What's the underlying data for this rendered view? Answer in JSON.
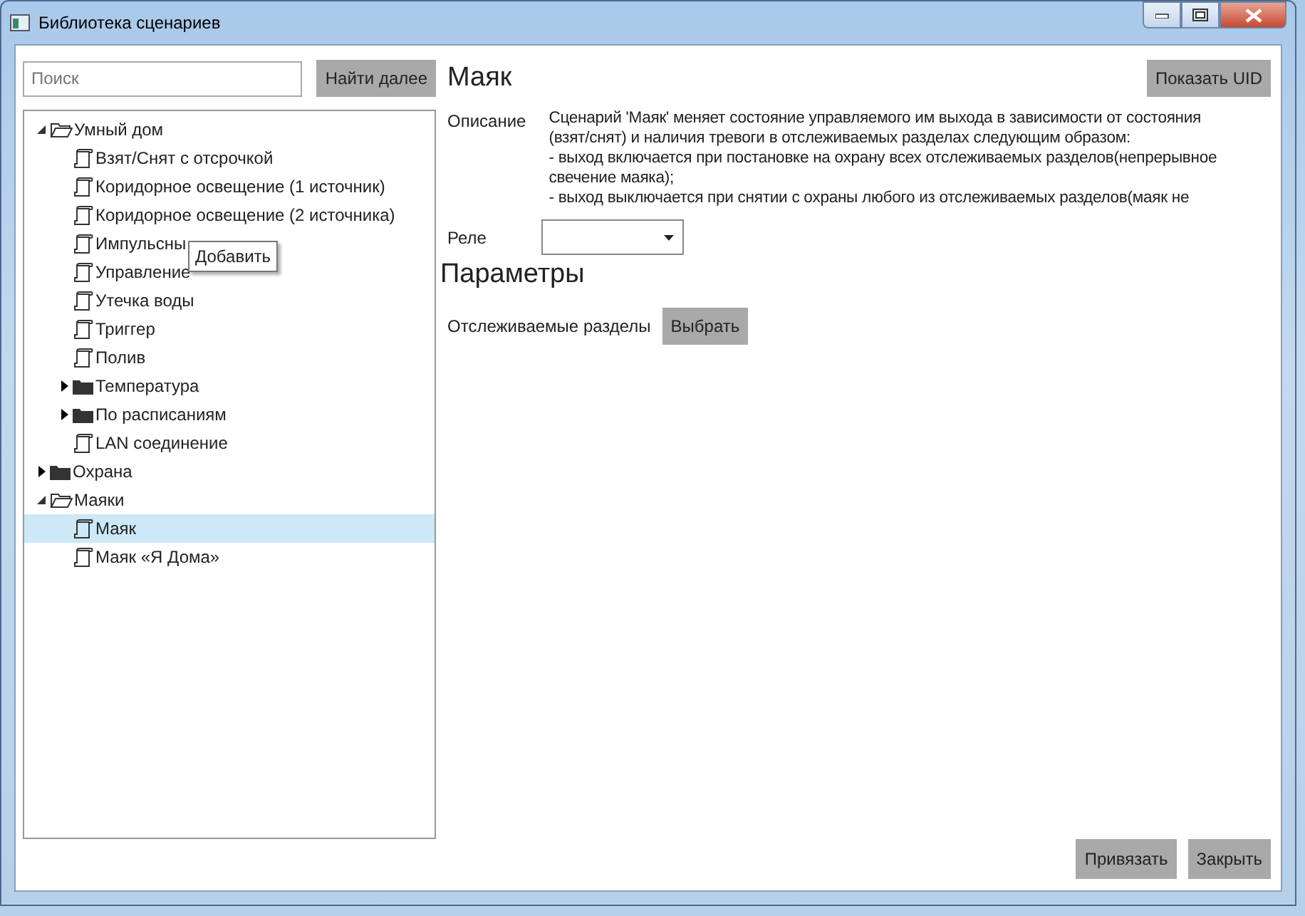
{
  "window": {
    "title": "Библиотека сценариев"
  },
  "search": {
    "placeholder": "Поиск"
  },
  "find_button": "Найти далее",
  "tree": [
    {
      "label": "Умный дом",
      "kind": "folder",
      "expanded": true,
      "selected": false,
      "children": [
        {
          "label": "Взят/Снят с отсрочкой",
          "kind": "script",
          "selected": false
        },
        {
          "label": "Коридорное освещение (1 источник)",
          "kind": "script",
          "selected": false
        },
        {
          "label": "Коридорное освещение (2 источника)",
          "kind": "script",
          "selected": false
        },
        {
          "label": "Импульсны",
          "kind": "script",
          "selected": false
        },
        {
          "label": "Управление",
          "kind": "script",
          "selected": false
        },
        {
          "label": "Утечка воды",
          "kind": "script",
          "selected": false
        },
        {
          "label": "Триггер",
          "kind": "script",
          "selected": false
        },
        {
          "label": "Полив",
          "kind": "script",
          "selected": false
        },
        {
          "label": "Температура",
          "kind": "folder",
          "expanded": false,
          "selected": false
        },
        {
          "label": "По расписаниям",
          "kind": "folder",
          "expanded": false,
          "selected": false
        },
        {
          "label": "LAN соединение",
          "kind": "script",
          "selected": false
        }
      ]
    },
    {
      "label": "Охрана",
      "kind": "folder",
      "expanded": false,
      "selected": false
    },
    {
      "label": "Маяки",
      "kind": "folder",
      "expanded": true,
      "selected": false,
      "children": [
        {
          "label": "Маяк",
          "kind": "script",
          "selected": true
        },
        {
          "label": "Маяк «Я Дома»",
          "kind": "script",
          "selected": false
        }
      ]
    }
  ],
  "tooltip": "Добавить",
  "detail": {
    "title": "Маяк",
    "uid_button": "Показать UID",
    "description_label": "Описание",
    "description": "Сценарий 'Маяк' меняет состояние управляемого им выхода в зависимости от состояния\n(взят/снят) и наличия тревоги в отслеживаемых разделах следующим образом:\n - выход включается при постановке на охрану всех отслеживаемых разделов(непрерывное\nсвечение маяка);\n - выход выключается при снятии с охраны любого из отслеживаемых разделов(маяк не",
    "relay_label": "Реле",
    "parameters_heading": "Параметры",
    "sections_label": "Отслеживаемые разделы",
    "choose_button": "Выбрать"
  },
  "footer_buttons": [
    "Привязать",
    "Закрыть"
  ]
}
